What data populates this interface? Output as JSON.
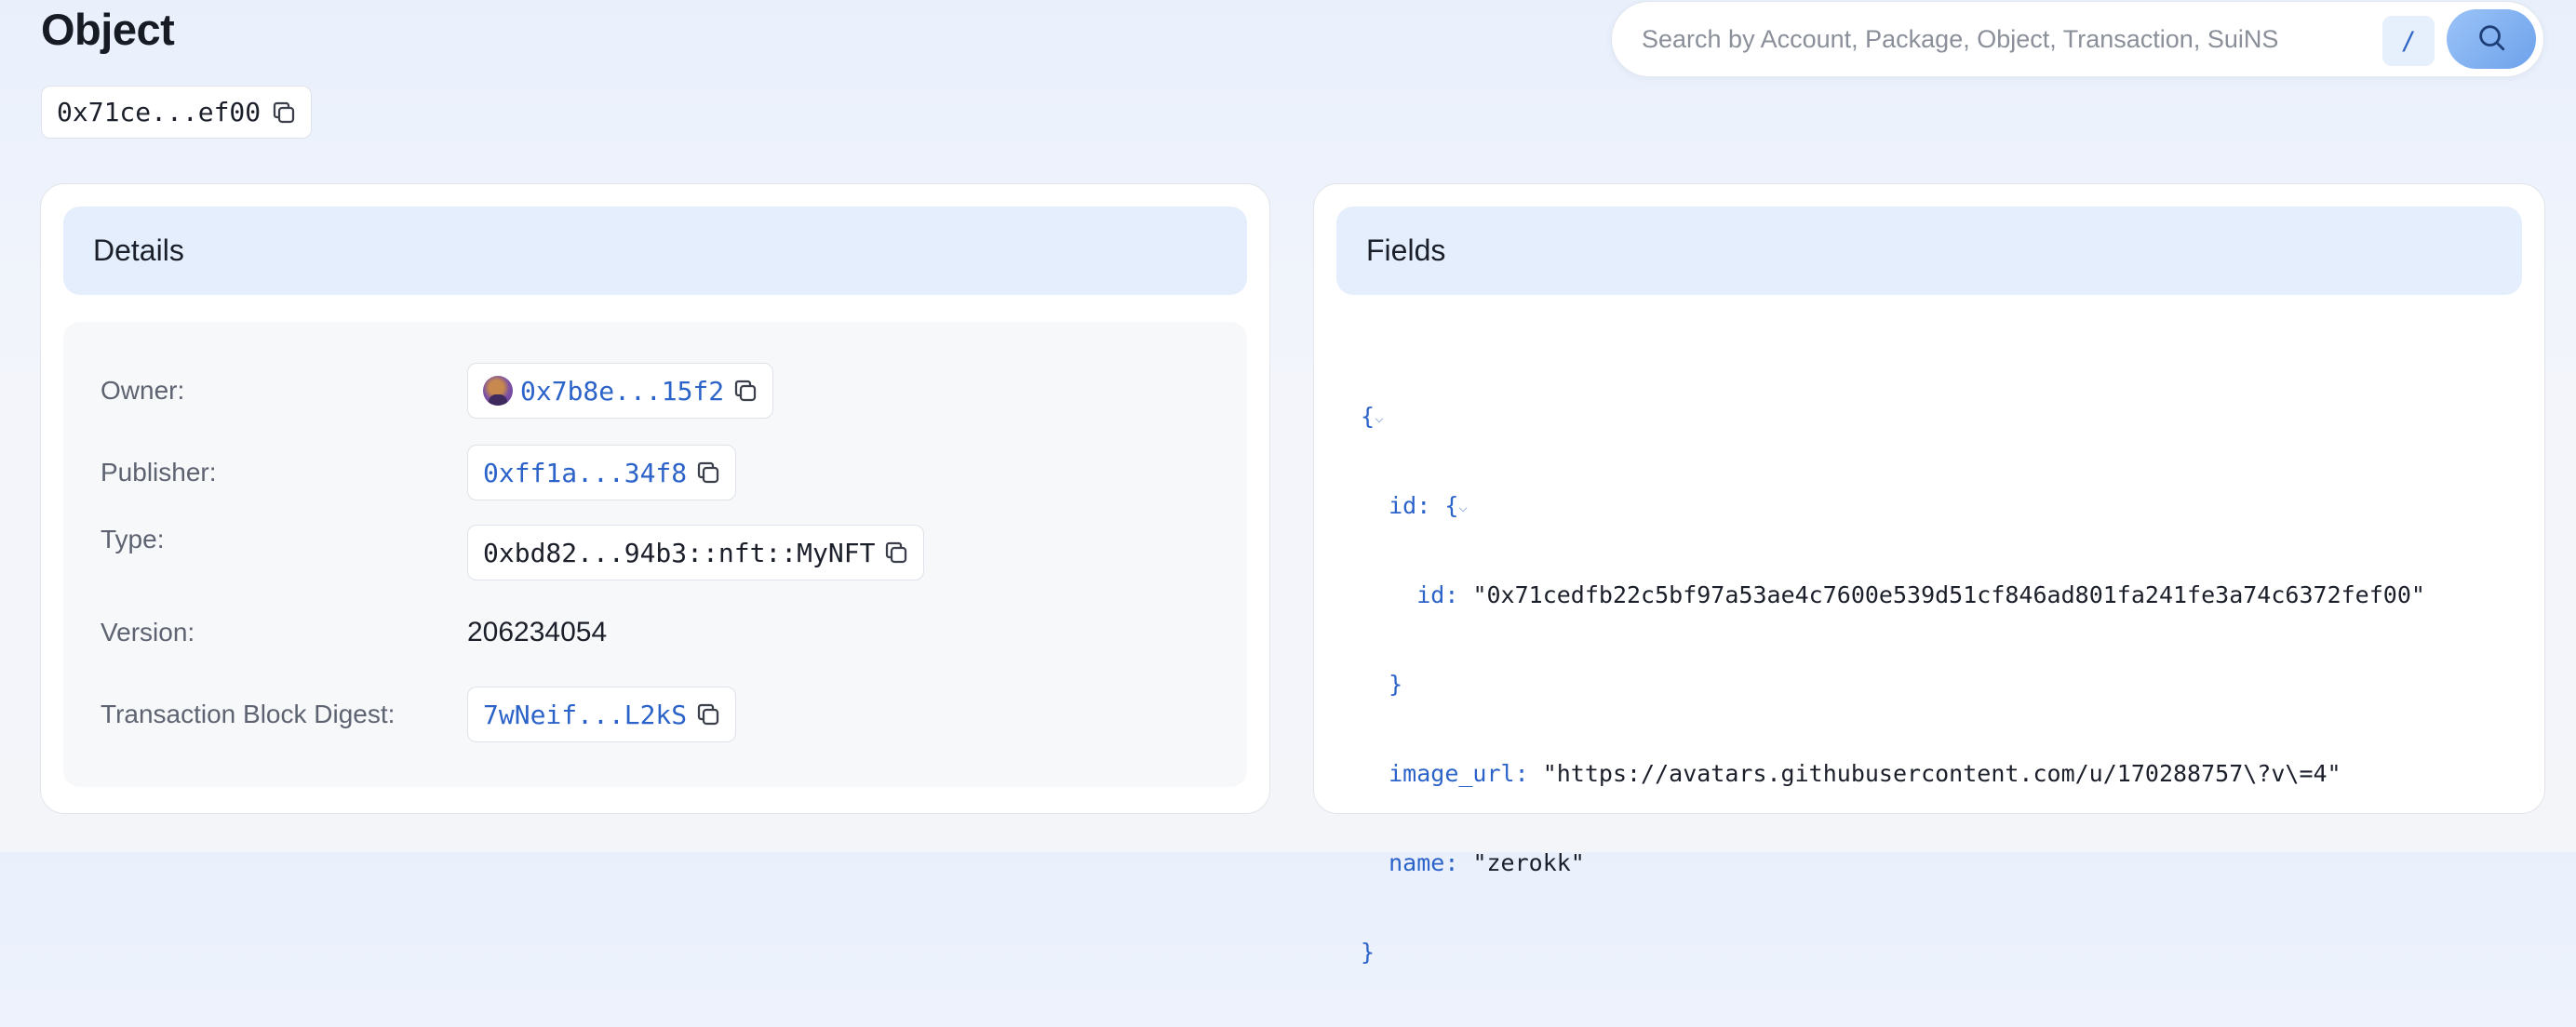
{
  "page": {
    "title": "Object",
    "object_id_short": "0x71ce...ef00"
  },
  "search": {
    "placeholder": "Search by Account, Package, Object, Transaction, SuiNS",
    "shortcut": "/"
  },
  "details": {
    "title": "Details",
    "owner": {
      "label": "Owner:",
      "value": "0x7b8e...15f2"
    },
    "publisher": {
      "label": "Publisher:",
      "value": "0xff1a...34f8"
    },
    "type": {
      "label": "Type:",
      "value": "0xbd82...94b3::nft::MyNFT"
    },
    "version": {
      "label": "Version:",
      "value": "206234054"
    },
    "digest": {
      "label": "Transaction Block Digest:",
      "value": "7wNeif...L2kS"
    }
  },
  "fields": {
    "title": "Fields",
    "json": {
      "open": "{",
      "close": "}",
      "id_key": "id",
      "id_open": "{",
      "id_close": "}",
      "inner_id_key": "id",
      "inner_id_value": "\"0x71cedfb22c5bf97a53ae4c7600e539d51cf846ad801fa241fe3a74c6372fef00\"",
      "image_url_key": "image_url",
      "image_url_value": "\"https://avatars.githubusercontent.com/u/170288757\\?v\\=4\"",
      "name_key": "name",
      "name_value": "\"zerokk\""
    }
  },
  "icons": {
    "copy": "copy-icon",
    "search": "search-icon",
    "chevron": "chevron-down-icon",
    "avatar": "owner-avatar"
  },
  "colors": {
    "link": "#2c63c9",
    "accent": "#6ea2ec",
    "card_head": "#e4eefc"
  }
}
